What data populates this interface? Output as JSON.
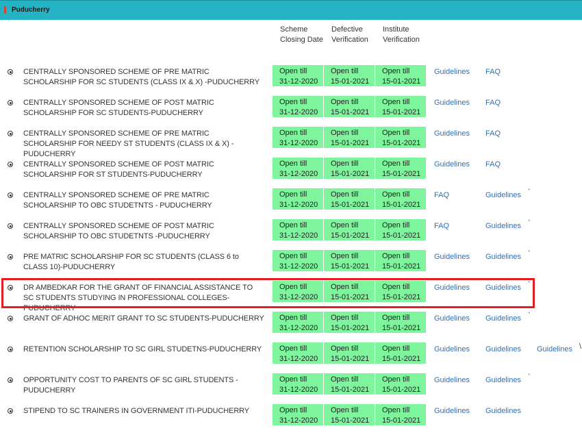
{
  "region": {
    "title": "Puducherry"
  },
  "columns": {
    "closing": "Scheme Closing Date",
    "defective": "Defective Verification",
    "institute": "Institute Verification"
  },
  "rows": [
    {
      "name": "CENTRALLY SPONSORED SCHEME OF PRE MATRIC SCHOLARSHIP FOR SC STUDENTS (CLASS IX & X) -PUDUCHERRY",
      "closing": [
        "Open till",
        "31-12-2020"
      ],
      "defective": [
        "Open till",
        "15-01-2021"
      ],
      "institute": [
        "Open till",
        "15-01-2021"
      ],
      "link1": "Guidelines",
      "link2": "FAQ",
      "link3": "",
      "tick": ""
    },
    {
      "name": "CENTRALLY SPONSORED SCHEME OF POST MATRIC SCHOLARSHIP FOR SC STUDENTS-PUDUCHERRY",
      "closing": [
        "Open till",
        "31-12-2020"
      ],
      "defective": [
        "Open till",
        "15-01-2021"
      ],
      "institute": [
        "Open till",
        "15-01-2021"
      ],
      "link1": "Guidelines",
      "link2": "FAQ",
      "link3": "",
      "tick": ""
    },
    {
      "name": "CENTRALLY SPONSORED SCHEME OF PRE MATRIC SCHOLARSHIP FOR NEEDY ST STUDENTS (CLASS IX & X) -PUDUCHERRY",
      "closing": [
        "Open till",
        "31-12-2020"
      ],
      "defective": [
        "Open till",
        "15-01-2021"
      ],
      "institute": [
        "Open till",
        "15-01-2021"
      ],
      "link1": "Guidelines",
      "link2": "FAQ",
      "link3": "",
      "tick": ""
    },
    {
      "name": "CENTRALLY SPONSORED SCHEME OF POST MATRIC SCHOLARSHIP FOR ST STUDENTS-PUDUCHERRY",
      "closing": [
        "Open till",
        "31-12-2020"
      ],
      "defective": [
        "Open till",
        "15-01-2021"
      ],
      "institute": [
        "Open till",
        "15-01-2021"
      ],
      "link1": "Guidelines",
      "link2": "FAQ",
      "link3": "",
      "tick": ""
    },
    {
      "name": "CENTRALLY SPONSORED SCHEME OF PRE MATRIC SCHOLARSHIP TO OBC STUDETNTS - PUDUCHERRY",
      "closing": [
        "Open till",
        "31-12-2020"
      ],
      "defective": [
        "Open till",
        "15-01-2021"
      ],
      "institute": [
        "Open till",
        "15-01-2021"
      ],
      "link1": "FAQ",
      "link2": "Guidelines",
      "link3": "",
      "tick": "`"
    },
    {
      "name": "CENTRALLY SPONSORED SCHEME OF POST MATRIC SCHOLARSHIP TO OBC STUDETNTS -PUDUCHERRY",
      "closing": [
        "Open till",
        "31-12-2020"
      ],
      "defective": [
        "Open till",
        "15-01-2021"
      ],
      "institute": [
        "Open till",
        "15-01-2021"
      ],
      "link1": "FAQ",
      "link2": "Guidelines",
      "link3": "",
      "tick": "`"
    },
    {
      "name": "PRE MATRIC SCHOLARSHIP FOR SC STUDENTS (CLASS 6 to CLASS 10)-PUDUCHERRY",
      "closing": [
        "Open till",
        "31-12-2020"
      ],
      "defective": [
        "Open till",
        "15-01-2021"
      ],
      "institute": [
        "Open till",
        "15-01-2021"
      ],
      "link1": "Guidelines",
      "link2": "Guidelines",
      "link3": "",
      "tick": "`"
    },
    {
      "name": "DR AMBEDKAR FOR THE GRANT OF FINANCIAL ASSISTANCE TO SC STUDENTS STUDYING IN PROFESSIONAL COLLEGES-PUDUCHERRY",
      "closing": [
        "Open till",
        "31-12-2020"
      ],
      "defective": [
        "Open till",
        "15-01-2021"
      ],
      "institute": [
        "Open till",
        "15-01-2021"
      ],
      "link1": "Guidelines",
      "link2": "Guidelines",
      "link3": "",
      "tick": "`"
    },
    {
      "name": "GRANT OF ADHOC MERIT GRANT TO SC STUDENTS-PUDUCHERRY",
      "closing": [
        "Open till",
        "31-12-2020"
      ],
      "defective": [
        "Open till",
        "15-01-2021"
      ],
      "institute": [
        "Open till",
        "15-01-2021"
      ],
      "link1": "Guidelines",
      "link2": "Guidelines",
      "link3": "",
      "tick": "`"
    },
    {
      "name": "RETENTION SCHOLARSHIP TO SC GIRL STUDETNS-PUDUCHERRY",
      "closing": [
        "Open till",
        "31-12-2020"
      ],
      "defective": [
        "Open till",
        "15-01-2021"
      ],
      "institute": [
        "Open till",
        "15-01-2021"
      ],
      "link1": "Guidelines",
      "link2": "Guidelines",
      "link3": "Guidelines",
      "tick": ""
    },
    {
      "name": "OPPORTUNITY COST TO PARENTS OF SC GIRL STUDENTS -PUDUCHERRY",
      "closing": [
        "Open till",
        "31-12-2020"
      ],
      "defective": [
        "Open till",
        "15-01-2021"
      ],
      "institute": [
        "Open till",
        "15-01-2021"
      ],
      "link1": "Guidelines",
      "link2": "Guidelines",
      "link3": "",
      "tick": "`"
    },
    {
      "name": "STIPEND TO SC TRAINERS IN GOVERNMENT ITI-PUDUCHERRY",
      "closing": [
        "Open till",
        "31-12-2020"
      ],
      "defective": [
        "Open till",
        "15-01-2021"
      ],
      "institute": [
        "Open till",
        "15-01-2021"
      ],
      "link1": "Guidelines",
      "link2": "Guidelines",
      "link3": "",
      "tick": ""
    }
  ],
  "edge_mark": "\\"
}
